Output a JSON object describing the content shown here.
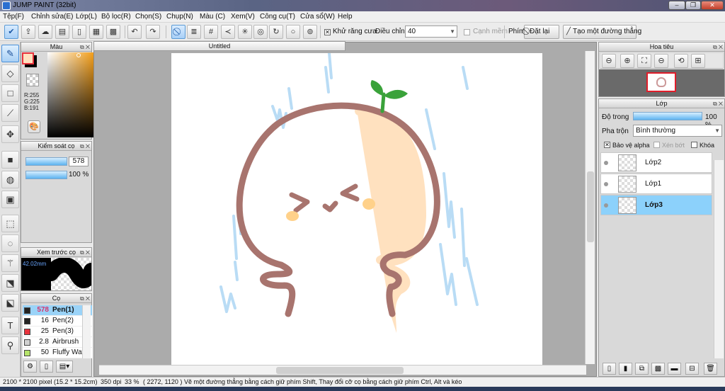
{
  "window": {
    "title": "JUMP PAINT (32bit)",
    "controls": {
      "minimize": "–",
      "restore": "❐",
      "close": "✕"
    }
  },
  "menu": [
    "Tệp(F)",
    "Chỉnh sửa(E)",
    "Lớp(L)",
    "Bộ lọc(R)",
    "Chọn(S)",
    "Chụp(N)",
    "Màu (C)",
    "Xem(V)",
    "Công cụ(T)",
    "Cửa sổ(W)",
    "Help"
  ],
  "toolbar": {
    "antialias_label": "Khử răng cưa",
    "adjust_label": "Điều chỉnh",
    "adjust_value": "40",
    "smooth_label": "Cạnh mềm",
    "key_label": "Phím",
    "reset_label": "Đặt lại",
    "straight_line_label": "Tạo một đường thẳng"
  },
  "color_panel": {
    "title": "Màu",
    "r": "R:255",
    "g": "G:225",
    "b": "B:191",
    "primary": "#ffe1bf",
    "secondary": "#000000"
  },
  "brush_control": {
    "title": "Kiểm soát cọ",
    "size": "578",
    "opacity": "100 %"
  },
  "brush_preview": {
    "title": "Xem trước cọ",
    "size_label": "42.02mm"
  },
  "brush_panel": {
    "title": "Cọ",
    "items": [
      {
        "size": "578",
        "name": "Pen(1)",
        "color": "#222222"
      },
      {
        "size": "16",
        "name": "Pen(2)",
        "color": "#222222"
      },
      {
        "size": "25",
        "name": "Pen(3)",
        "color": "#e8323c"
      },
      {
        "size": "2.8",
        "name": "Airbrush",
        "color": "#d0d0d0"
      },
      {
        "size": "50",
        "name": "Fluffy Water",
        "color": "#b5e36a"
      }
    ]
  },
  "document": {
    "tab_title": "Untitled"
  },
  "navigator": {
    "title": "Hoa tiêu"
  },
  "layers_panel": {
    "title": "Lớp",
    "opacity_label": "Độ trong",
    "opacity_value": "100 %",
    "blend_label": "Pha trộn",
    "blend_value": "Bình thường",
    "protect_alpha_label": "Bảo vệ alpha",
    "clip_label": "Xén bớt",
    "lock_label": "Khóa",
    "layers": [
      {
        "name": "Lớp2",
        "selected": false
      },
      {
        "name": "Lớp1",
        "selected": false
      },
      {
        "name": "Lớp3",
        "selected": true
      }
    ]
  },
  "status": {
    "size": "2100 * 2100 pixel",
    "size_cm": "(15.2 * 15.2cm)",
    "dpi": "350 dpi",
    "zoom": "33 %",
    "coords": "( 2272, 1120 )",
    "hint": "Vẽ một đường thẳng bằng cách giữ phím Shift, Thay đổi cỡ cọ bằng cách giữ phím Ctrl, Alt và kéo"
  }
}
